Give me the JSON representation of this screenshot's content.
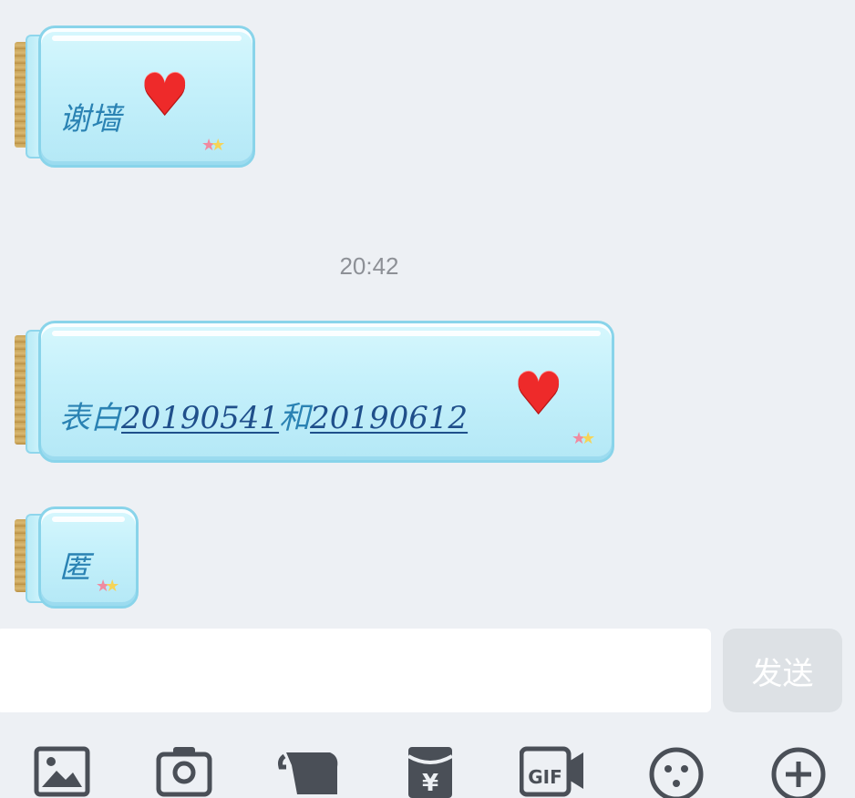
{
  "messages": [
    {
      "text": "谢墙",
      "sticker": "heart-icon"
    },
    {
      "prefix": "表白",
      "link1": "20190541",
      "joiner": "和",
      "link2": "20190612",
      "sticker": "heart-icon"
    },
    {
      "text": "匿"
    }
  ],
  "timestamp": "20:42",
  "composer": {
    "input_value": "",
    "send_label": "发送"
  },
  "toolbar": {
    "items": [
      {
        "icon": "image-icon"
      },
      {
        "icon": "camera-icon"
      },
      {
        "icon": "scroll-icon"
      },
      {
        "icon": "red-packet-icon",
        "glyph": "¥"
      },
      {
        "icon": "gif-icon",
        "glyph": "GIF"
      },
      {
        "icon": "emoji-icon"
      },
      {
        "icon": "plus-icon"
      }
    ]
  },
  "colors": {
    "background": "#edf0f4",
    "jar_fill": "#c6f1fb",
    "jar_border": "#89d4ea",
    "text": "#2a82b3",
    "link": "#1f4f8b",
    "heart": "#ee2a2a",
    "send_button_bg": "#dde1e5",
    "toolbar_icon": "#4a4f57"
  }
}
